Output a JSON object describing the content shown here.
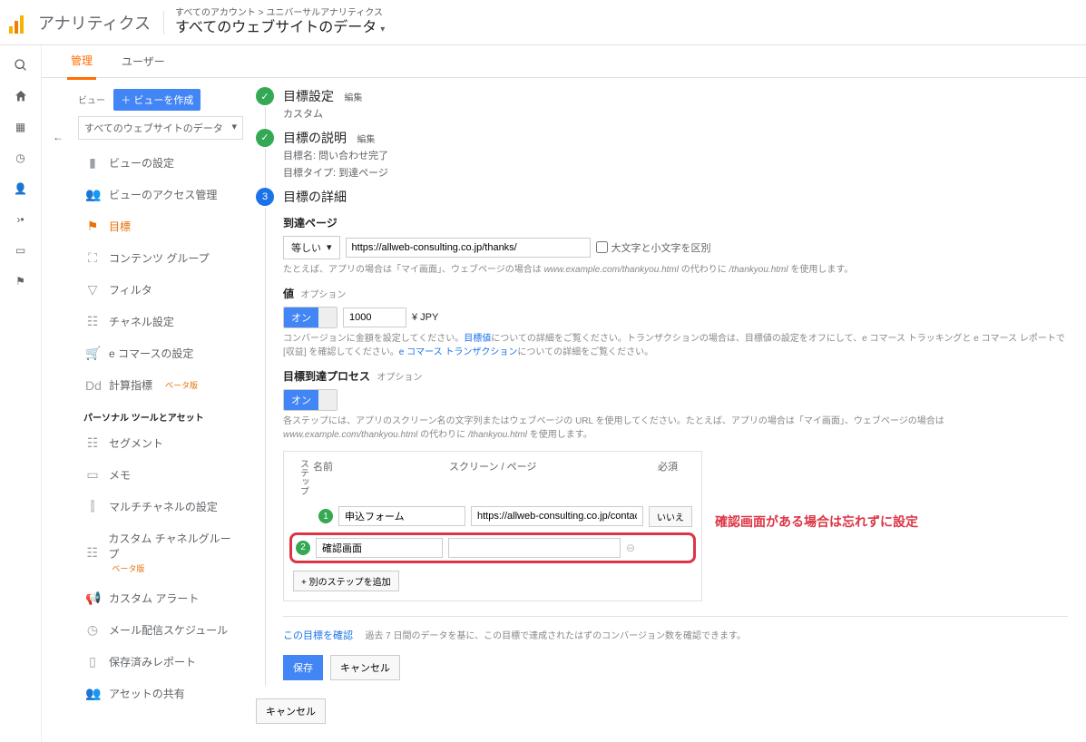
{
  "header": {
    "app": "アナリティクス",
    "crumb": "すべてのアカウント > ユニバーサルアナリティクス",
    "property": "すべてのウェブサイトのデータ"
  },
  "tabs": {
    "admin": "管理",
    "users": "ユーザー"
  },
  "view": {
    "label": "ビュー",
    "create": "＋ ビューを作成",
    "selected": "すべてのウェブサイトのデータ"
  },
  "side": {
    "settings": "ビューの設定",
    "access": "ビューのアクセス管理",
    "goals": "目標",
    "groups": "コンテンツ グループ",
    "filters": "フィルタ",
    "channel": "チャネル設定",
    "ecom": "e コマースの設定",
    "calc": "計算指標",
    "beta": "ベータ版",
    "section": "パーソナル ツールとアセット",
    "seg": "セグメント",
    "notes": "メモ",
    "multi": "マルチチャネルの設定",
    "custch": "カスタム チャネルグループ",
    "alert": "カスタム アラート",
    "mail": "メール配信スケジュール",
    "saved": "保存済みレポート",
    "share": "アセットの共有"
  },
  "steps": {
    "s1": {
      "title": "目標設定",
      "edit": "編集",
      "sub": "カスタム"
    },
    "s2": {
      "title": "目標の説明",
      "edit": "編集",
      "sub1": "目標名: 問い合わせ完了",
      "sub2": "目標タイプ: 到達ページ"
    },
    "s3": {
      "title": "目標の詳細"
    }
  },
  "dest": {
    "label": "到達ページ",
    "match": "等しい",
    "url": "https://allweb-consulting.co.jp/thanks/",
    "case": "大文字と小文字を区別",
    "help1": "たとえば、アプリの場合は「マイ画面」、ウェブページの場合は ",
    "helpE1": "www.example.com/thankyou.html",
    "help2": " の代わりに ",
    "helpE2": "/thankyou.html",
    "help3": " を使用します。"
  },
  "value": {
    "label": "値",
    "opt": "オプション",
    "toggle_on": "オン",
    "amount": "1000",
    "currency": "¥ JPY",
    "help1": "コンバージョンに金額を設定してください。",
    "link1": "目標値",
    "help2": "についての詳細をご覧ください。トランザクションの場合は、目標値の設定をオフにして、e コマース トラッキングと e コマース レポートで [収益] を確認してください。",
    "link2": "e コマース トランザクション",
    "help3": "についての詳細をご覧ください。"
  },
  "funnel": {
    "label": "目標到達プロセス",
    "opt": "オプション",
    "toggle_on": "オン",
    "help": "各ステップには、アプリのスクリーン名の文字列またはウェブページの URL を使用してください。たとえば、アプリの場合は「マイ画面」、ウェブページの場合は ",
    "helpE": "www.example.com/thankyou.html",
    "help2": " の代わりに ",
    "helpE2": "/thankyou.html",
    "help3": " を使用します。",
    "th_step": "ステップ",
    "th_name": "名前",
    "th_screen": "スクリーン / ページ",
    "th_req": "必須",
    "r1_name": "申込フォーム",
    "r1_url": "https://allweb-consulting.co.jp/contact/",
    "r1_req": "いいえ",
    "r2_name": "確認画面",
    "r2_url": "",
    "add": "+ 別のステップを追加"
  },
  "callout": "確認画面がある場合は忘れずに設定",
  "verify": {
    "link": "この目標を確認",
    "note": "過去 7 日間のデータを基に、この目標で達成されたはずのコンバージョン数を確認できます。"
  },
  "btn": {
    "save": "保存",
    "cancel": "キャンセル",
    "cancel2": "キャンセル"
  }
}
